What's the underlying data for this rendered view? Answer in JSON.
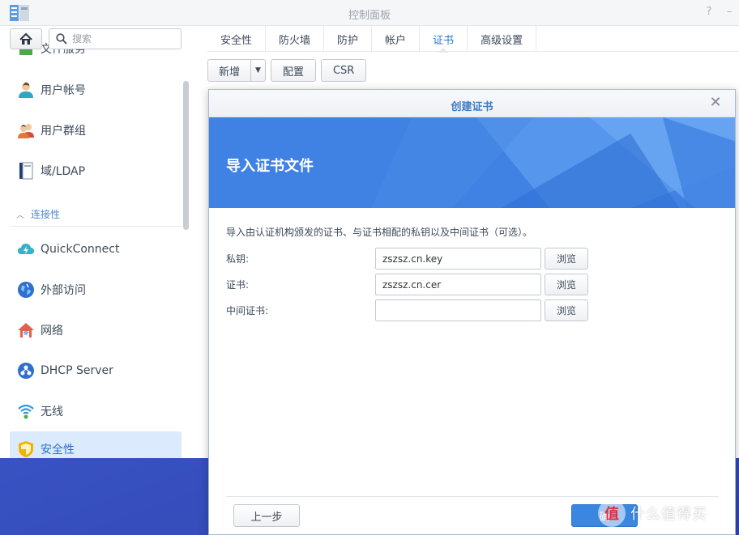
{
  "window": {
    "title": "控制面板",
    "help": "?",
    "minimize": "–"
  },
  "sidebar": {
    "search_placeholder": "搜索",
    "partial_item": "文件服务",
    "items": [
      {
        "label": "用户帐号",
        "icon": "user-icon"
      },
      {
        "label": "用户群组",
        "icon": "user-group-icon"
      },
      {
        "label": "域/LDAP",
        "icon": "ldap-icon"
      }
    ],
    "section": {
      "label": "连接性",
      "icon": "chevron-up-icon"
    },
    "connect_items": [
      {
        "label": "QuickConnect",
        "icon": "quickconnect-icon"
      },
      {
        "label": "外部访问",
        "icon": "globe-icon"
      },
      {
        "label": "网络",
        "icon": "network-home-icon"
      },
      {
        "label": "DHCP Server",
        "icon": "dhcp-icon"
      },
      {
        "label": "无线",
        "icon": "wifi-icon"
      },
      {
        "label": "安全性",
        "icon": "shield-icon",
        "active": true
      }
    ]
  },
  "tabs": [
    {
      "label": "安全性"
    },
    {
      "label": "防火墙"
    },
    {
      "label": "防护"
    },
    {
      "label": "帐户"
    },
    {
      "label": "证书",
      "active": true
    },
    {
      "label": "高级设置"
    }
  ],
  "toolbar": {
    "add_label": "新增",
    "config_label": "配置",
    "csr_label": "CSR"
  },
  "dialog": {
    "title": "创建证书",
    "banner_title": "导入证书文件",
    "description": "导入由认证机构颁发的证书、与证书相配的私钥以及中间证书（可选）。",
    "fields": [
      {
        "label": "私钥:",
        "value": "zszsz.cn.key",
        "browse": "浏览"
      },
      {
        "label": "证书:",
        "value": "zszsz.cn.cer",
        "browse": "浏览"
      },
      {
        "label": "中间证书:",
        "value": "",
        "browse": "浏览"
      }
    ],
    "prev_label": "上一步",
    "ok_label": "确"
  },
  "watermark": {
    "logo": "值",
    "text": "什么值得买"
  },
  "colors": {
    "accent": "#2b7bd6",
    "banner": "#3d7fe0",
    "active_item_bg": "#dbeafc",
    "desktop": "#3f5fc7"
  }
}
